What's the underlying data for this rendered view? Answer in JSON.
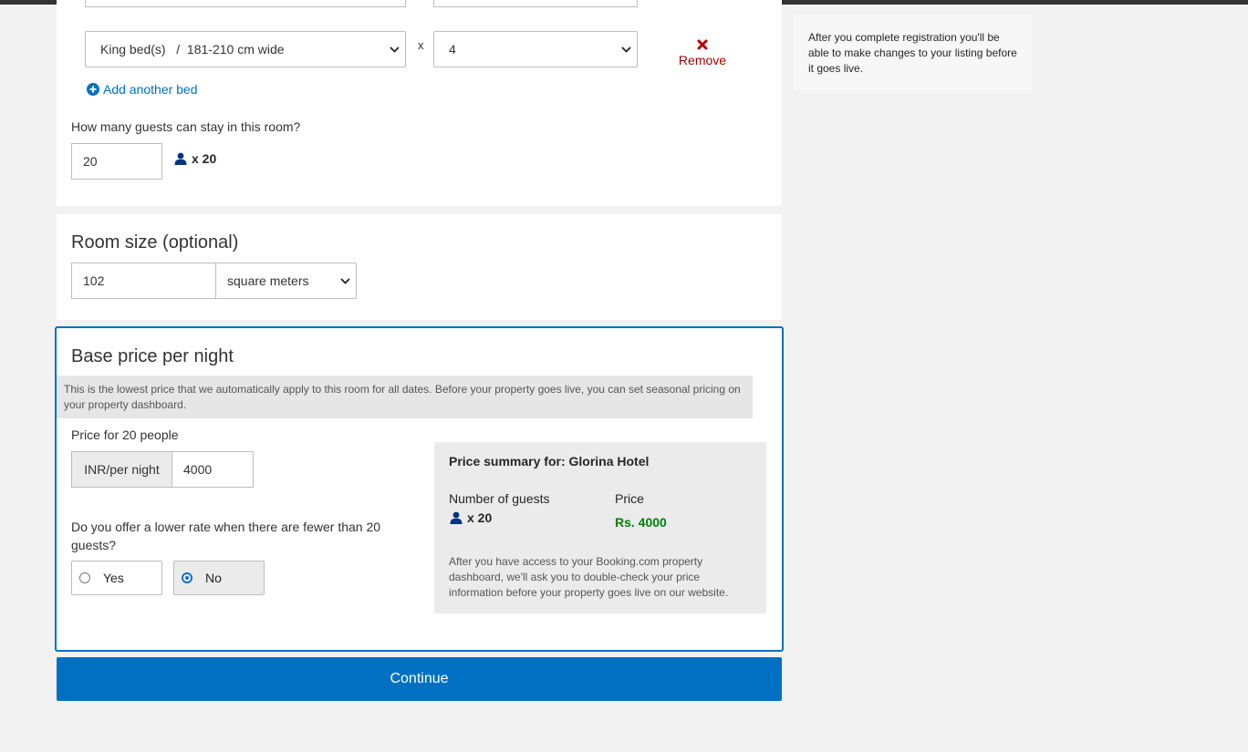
{
  "bed_row": {
    "bed_type": "King bed(s)   /  181-210 cm wide",
    "times": "x",
    "quantity": "4",
    "remove_label": "Remove"
  },
  "add_bed_label": "Add another bed",
  "guests": {
    "question": "How many guests can stay in this room?",
    "value": "20",
    "count_label": "x 20"
  },
  "room_size": {
    "title": "Room size (optional)",
    "value": "102",
    "unit": "square meters"
  },
  "base_price": {
    "title": "Base price per night",
    "info": "This is the lowest price that we automatically apply to this room for all dates. Before your property goes live, you can set seasonal pricing on your property dashboard.",
    "price_label": "Price for 20 people",
    "currency_label": "INR/per night",
    "price_value": "4000",
    "lower_rate_question": "Do you offer a lower rate when there are fewer than 20 guests?",
    "option_yes": "Yes",
    "option_no": "No",
    "selected": "No"
  },
  "summary": {
    "title": "Price summary for: Glorina Hotel",
    "col_guests": "Number of guests",
    "col_price": "Price",
    "guests_value": "x 20",
    "price_value": "Rs. 4000",
    "note": "After you have access to your Booking.com property dashboard, we'll ask you to double-check your price information before your property goes live on our website."
  },
  "continue_label": "Continue",
  "side_note": "After you complete registration you'll be able to make changes to your listing before it goes live.",
  "colors": {
    "accent_blue": "#0071c2",
    "price_green": "#008009",
    "remove_red": "#a30000",
    "guest_icon": "#003580"
  },
  "icons": {
    "remove": "x-icon",
    "add": "plus-circle-icon",
    "guest": "person-icon",
    "dropdown": "chevron-down-icon"
  }
}
